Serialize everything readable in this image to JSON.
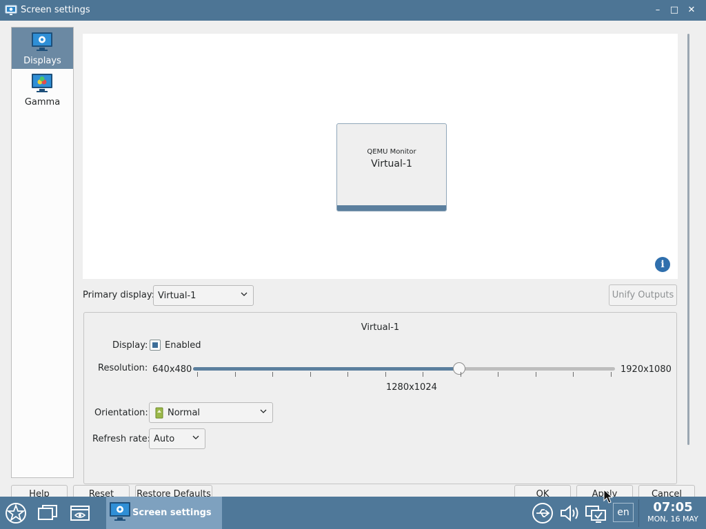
{
  "window": {
    "title": "Screen settings",
    "controls": {
      "minimize": "–",
      "maximize": "□",
      "close": "✕"
    }
  },
  "sidebar": {
    "items": [
      {
        "label": "Displays",
        "icon": "display-settings-icon",
        "selected": true
      },
      {
        "label": "Gamma",
        "icon": "gamma-monitor-icon",
        "selected": false
      }
    ]
  },
  "preview": {
    "monitor_model": "QEMU Monitor",
    "monitor_name": "Virtual-1"
  },
  "primary": {
    "label": "Primary display:",
    "value": "Virtual-1",
    "unify_label": "Unify Outputs"
  },
  "output": {
    "title": "Virtual-1",
    "display_label": "Display:",
    "enabled_label": "Enabled",
    "enabled": true,
    "resolution_label": "Resolution:",
    "resolution_min": "640x480",
    "resolution_max": "1920x1080",
    "resolution_current": "1280x1024",
    "resolution_fraction": 0.63,
    "orientation_label": "Orientation:",
    "orientation_value": "Normal",
    "refresh_label": "Refresh rate:",
    "refresh_value": "Auto"
  },
  "buttons": {
    "help": "Help",
    "reset": "Reset",
    "restore": "Restore Defaults",
    "ok": "OK",
    "apply": "Apply",
    "cancel": "Cancel"
  },
  "taskbar": {
    "task_label": "Screen settings",
    "lang": "en",
    "time": "07:05",
    "date": "MON, 16 MAY"
  },
  "colors": {
    "accent": "#4d7595",
    "selection": "#6b89a3",
    "slider": "#5b7f9e"
  }
}
